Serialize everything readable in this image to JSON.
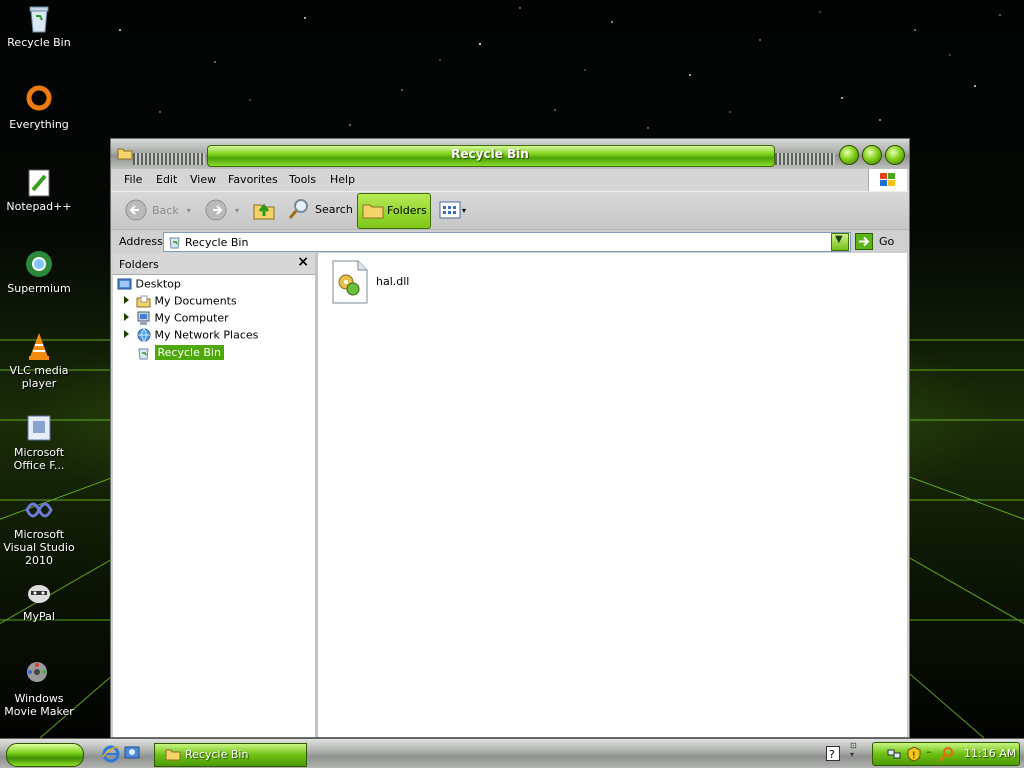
{
  "desktop": {
    "icons": [
      {
        "label": "Recycle Bin",
        "icon": "recycle-bin-icon"
      },
      {
        "label": "Everything",
        "icon": "everything-search-icon"
      },
      {
        "label": "Notepad++",
        "icon": "notepadpp-icon"
      },
      {
        "label": "Supermium",
        "icon": "supermium-browser-icon"
      },
      {
        "label": "VLC media player",
        "icon": "vlc-cone-icon"
      },
      {
        "label": "Microsoft Office F...",
        "icon": "office-file-icon"
      },
      {
        "label": "Microsoft Visual Studio 2010",
        "icon": "visual-studio-icon"
      },
      {
        "label": "MyPal",
        "icon": "mypal-raccoon-icon"
      },
      {
        "label": "Windows Movie Maker",
        "icon": "movie-maker-icon"
      }
    ]
  },
  "window": {
    "title": "Recycle Bin",
    "menu": [
      "File",
      "Edit",
      "View",
      "Favorites",
      "Tools",
      "Help"
    ],
    "toolbar": {
      "back": "Back",
      "search": "Search",
      "folders": "Folders"
    },
    "address": {
      "label": "Address",
      "value": "Recycle Bin",
      "go": "Go"
    },
    "folders_pane": {
      "title": "Folders",
      "close": "×",
      "tree": [
        {
          "label": "Desktop",
          "level": 0,
          "icon": "desktop-icon",
          "expandable": false,
          "selected": false
        },
        {
          "label": "My Documents",
          "level": 1,
          "icon": "my-documents-icon",
          "expandable": true,
          "selected": false
        },
        {
          "label": "My Computer",
          "level": 1,
          "icon": "my-computer-icon",
          "expandable": true,
          "selected": false
        },
        {
          "label": "My Network Places",
          "level": 1,
          "icon": "network-places-icon",
          "expandable": true,
          "selected": false
        },
        {
          "label": "Recycle Bin",
          "level": 1,
          "icon": "recycle-bin-icon",
          "expandable": false,
          "selected": true
        }
      ]
    },
    "files": [
      {
        "name": "hal.dll",
        "icon": "dll-file-icon"
      }
    ]
  },
  "taskbar": {
    "start": "",
    "task_button": "Recycle Bin",
    "clock": "11:16 AM"
  },
  "colors": {
    "accent": "#6fc012",
    "selection": "#4ea80a"
  }
}
